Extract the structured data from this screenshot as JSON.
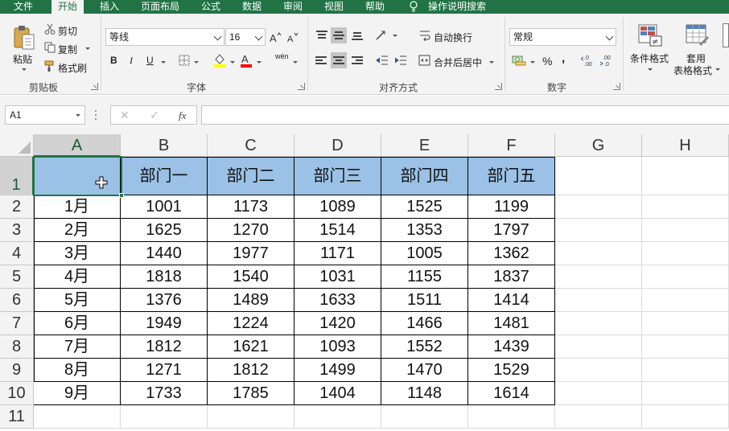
{
  "ribbon_tabs": [
    "文件",
    "开始",
    "插入",
    "页面布局",
    "公式",
    "数据",
    "审阅",
    "视图",
    "帮助"
  ],
  "tell_me": "操作说明搜索",
  "clipboard": {
    "paste": "粘贴",
    "cut": "剪切",
    "copy": "复制",
    "format_painter": "格式刷",
    "label": "剪贴板"
  },
  "font": {
    "name": "等线",
    "size": "16",
    "bold": "B",
    "italic": "I",
    "underline": "U",
    "phonetic": "wén",
    "label": "字体"
  },
  "alignment": {
    "wrap_text": "自动换行",
    "merge_center": "合并后居中",
    "label": "对齐方式"
  },
  "number": {
    "format": "常规",
    "percent": "%",
    "comma": ",",
    "label": "数字"
  },
  "styles": {
    "conditional": "条件格式",
    "table_format_1": "套用",
    "table_format_2": "表格格式"
  },
  "formula_bar": {
    "name_box": "A1",
    "cancel": "✕",
    "enter": "✓",
    "fx": "fx",
    "value": ""
  },
  "columns": [
    "A",
    "B",
    "C",
    "D",
    "E",
    "F",
    "G",
    "H"
  ],
  "rows": [
    "1",
    "2",
    "3",
    "4",
    "5",
    "6",
    "7",
    "8",
    "9",
    "10",
    "11"
  ],
  "table": {
    "header": [
      "",
      "部门一",
      "部门二",
      "部门三",
      "部门四",
      "部门五"
    ],
    "data": [
      [
        "1月",
        "1001",
        "1173",
        "1089",
        "1525",
        "1199"
      ],
      [
        "2月",
        "1625",
        "1270",
        "1514",
        "1353",
        "1797"
      ],
      [
        "3月",
        "1440",
        "1977",
        "1171",
        "1005",
        "1362"
      ],
      [
        "4月",
        "1818",
        "1540",
        "1031",
        "1155",
        "1837"
      ],
      [
        "5月",
        "1376",
        "1489",
        "1633",
        "1511",
        "1414"
      ],
      [
        "6月",
        "1949",
        "1224",
        "1420",
        "1466",
        "1481"
      ],
      [
        "7月",
        "1812",
        "1621",
        "1093",
        "1552",
        "1439"
      ],
      [
        "8月",
        "1271",
        "1812",
        "1499",
        "1470",
        "1529"
      ],
      [
        "9月",
        "1733",
        "1785",
        "1404",
        "1148",
        "1614"
      ]
    ]
  },
  "colors": {
    "accent": "#217346",
    "header_fill": "#9bc2e6",
    "font_color": "#ff0000",
    "fill_color": "#ffff00"
  }
}
